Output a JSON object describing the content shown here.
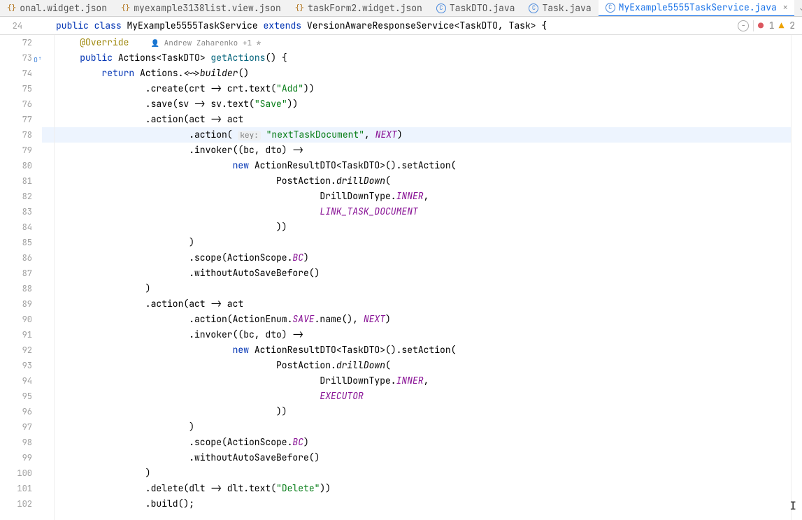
{
  "tabs": [
    {
      "label": "onal.widget.json",
      "type": "json",
      "active": false
    },
    {
      "label": "myexample3138list.view.json",
      "type": "json",
      "active": false
    },
    {
      "label": "taskForm2.widget.json",
      "type": "json",
      "active": false
    },
    {
      "label": "TaskDTO.java",
      "type": "java",
      "active": false
    },
    {
      "label": "Task.java",
      "type": "java",
      "active": false
    },
    {
      "label": "MyExample5555TaskService.java",
      "type": "java",
      "active": true
    }
  ],
  "classDecl": {
    "lineNo": "24",
    "kw_public": "public",
    "kw_class": "class",
    "className": "MyExample5555TaskService",
    "kw_extends": "extends",
    "superType": "VersionAwareResponseService",
    "lt": "<",
    "gp1": "TaskDTO",
    "comma": ", ",
    "gp2": "Task",
    "gt": ">",
    "brace": " {"
  },
  "statusBar": {
    "errorCount": "1",
    "warningCount": "2"
  },
  "authors": "Andrew Zaharenko +1 *",
  "lines": [
    {
      "no": "72",
      "indent": 4,
      "segs": [
        {
          "t": "@Override",
          "cls": "anno"
        },
        {
          "t": "    ",
          "cls": ""
        },
        {
          "t": "authors",
          "cls": "authors-slot"
        }
      ]
    },
    {
      "no": "73",
      "override": true,
      "indent": 4,
      "segs": [
        {
          "t": "public",
          "cls": "kw"
        },
        {
          "t": " Actions<TaskDTO> ",
          "cls": ""
        },
        {
          "t": "getActions",
          "cls": "fn"
        },
        {
          "t": "() {",
          "cls": ""
        }
      ]
    },
    {
      "no": "74",
      "indent": 8,
      "segs": [
        {
          "t": "return",
          "cls": "kw"
        },
        {
          "t": " Actions.<~>",
          "cls": ""
        },
        {
          "t": "builder",
          "cls": "italic"
        },
        {
          "t": "()",
          "cls": ""
        }
      ]
    },
    {
      "no": "75",
      "indent": 16,
      "segs": [
        {
          "t": ".create(crt -> crt.text(",
          "cls": ""
        },
        {
          "t": "\"Add\"",
          "cls": "str"
        },
        {
          "t": "))",
          "cls": ""
        }
      ]
    },
    {
      "no": "76",
      "indent": 16,
      "segs": [
        {
          "t": ".save(sv -> sv.text(",
          "cls": ""
        },
        {
          "t": "\"Save\"",
          "cls": "str"
        },
        {
          "t": "))",
          "cls": ""
        }
      ]
    },
    {
      "no": "77",
      "indent": 16,
      "segs": [
        {
          "t": ".action(act -> act",
          "cls": ""
        }
      ]
    },
    {
      "no": "78",
      "hl": true,
      "indent": 24,
      "segs": [
        {
          "t": ".action( ",
          "cls": ""
        },
        {
          "t": "key:",
          "cls": "param-hint"
        },
        {
          "t": " ",
          "cls": ""
        },
        {
          "t": "\"nextTaskDocument\"",
          "cls": "str"
        },
        {
          "t": ", ",
          "cls": ""
        },
        {
          "t": "NEXT",
          "cls": "fld"
        },
        {
          "t": ")",
          "cls": ""
        }
      ]
    },
    {
      "no": "79",
      "indent": 24,
      "segs": [
        {
          "t": ".invoker((bc, dto) ->",
          "cls": ""
        }
      ]
    },
    {
      "no": "80",
      "indent": 32,
      "segs": [
        {
          "t": "new",
          "cls": "kw"
        },
        {
          "t": " ActionResultDTO<TaskDTO>().setAction(",
          "cls": ""
        }
      ]
    },
    {
      "no": "81",
      "indent": 40,
      "segs": [
        {
          "t": "PostAction.",
          "cls": ""
        },
        {
          "t": "drillDown",
          "cls": "italic"
        },
        {
          "t": "(",
          "cls": ""
        }
      ]
    },
    {
      "no": "82",
      "indent": 48,
      "segs": [
        {
          "t": "DrillDownType.",
          "cls": ""
        },
        {
          "t": "INNER",
          "cls": "fld"
        },
        {
          "t": ",",
          "cls": ""
        }
      ]
    },
    {
      "no": "83",
      "indent": 48,
      "segs": [
        {
          "t": "LINK_TASK_DOCUMENT",
          "cls": "fld2"
        }
      ]
    },
    {
      "no": "84",
      "indent": 40,
      "segs": [
        {
          "t": "))",
          "cls": ""
        }
      ]
    },
    {
      "no": "85",
      "indent": 24,
      "segs": [
        {
          "t": ")",
          "cls": ""
        }
      ]
    },
    {
      "no": "86",
      "indent": 24,
      "segs": [
        {
          "t": ".scope(ActionScope.",
          "cls": ""
        },
        {
          "t": "BC",
          "cls": "fld"
        },
        {
          "t": ")",
          "cls": ""
        }
      ]
    },
    {
      "no": "87",
      "indent": 24,
      "segs": [
        {
          "t": ".withoutAutoSaveBefore()",
          "cls": ""
        }
      ]
    },
    {
      "no": "88",
      "indent": 16,
      "segs": [
        {
          "t": ")",
          "cls": ""
        }
      ]
    },
    {
      "no": "89",
      "indent": 16,
      "segs": [
        {
          "t": ".action(act -> act",
          "cls": ""
        }
      ]
    },
    {
      "no": "90",
      "indent": 24,
      "segs": [
        {
          "t": ".action(ActionEnum.",
          "cls": ""
        },
        {
          "t": "SAVE",
          "cls": "fld"
        },
        {
          "t": ".name(), ",
          "cls": ""
        },
        {
          "t": "NEXT",
          "cls": "fld"
        },
        {
          "t": ")",
          "cls": ""
        }
      ]
    },
    {
      "no": "91",
      "indent": 24,
      "segs": [
        {
          "t": ".invoker((bc, dto) ->",
          "cls": ""
        }
      ]
    },
    {
      "no": "92",
      "indent": 32,
      "segs": [
        {
          "t": "new",
          "cls": "kw"
        },
        {
          "t": " ActionResultDTO<TaskDTO>().setAction(",
          "cls": ""
        }
      ]
    },
    {
      "no": "93",
      "indent": 40,
      "segs": [
        {
          "t": "PostAction.",
          "cls": ""
        },
        {
          "t": "drillDown",
          "cls": "italic"
        },
        {
          "t": "(",
          "cls": ""
        }
      ]
    },
    {
      "no": "94",
      "indent": 48,
      "segs": [
        {
          "t": "DrillDownType.",
          "cls": ""
        },
        {
          "t": "INNER",
          "cls": "fld"
        },
        {
          "t": ",",
          "cls": ""
        }
      ]
    },
    {
      "no": "95",
      "indent": 48,
      "segs": [
        {
          "t": "EXECUTOR",
          "cls": "fld2"
        }
      ]
    },
    {
      "no": "96",
      "indent": 40,
      "segs": [
        {
          "t": "))",
          "cls": ""
        }
      ]
    },
    {
      "no": "97",
      "indent": 24,
      "segs": [
        {
          "t": ")",
          "cls": ""
        }
      ]
    },
    {
      "no": "98",
      "indent": 24,
      "segs": [
        {
          "t": ".scope(ActionScope.",
          "cls": ""
        },
        {
          "t": "BC",
          "cls": "fld"
        },
        {
          "t": ")",
          "cls": ""
        }
      ]
    },
    {
      "no": "99",
      "indent": 24,
      "segs": [
        {
          "t": ".withoutAutoSaveBefore()",
          "cls": ""
        }
      ]
    },
    {
      "no": "100",
      "indent": 16,
      "segs": [
        {
          "t": ")",
          "cls": ""
        }
      ]
    },
    {
      "no": "101",
      "indent": 16,
      "segs": [
        {
          "t": ".delete(dlt -> dlt.text(",
          "cls": ""
        },
        {
          "t": "\"Delete\"",
          "cls": "str"
        },
        {
          "t": "))",
          "cls": ""
        }
      ]
    },
    {
      "no": "102",
      "indent": 16,
      "segs": [
        {
          "t": ".build();",
          "cls": ""
        }
      ]
    }
  ]
}
